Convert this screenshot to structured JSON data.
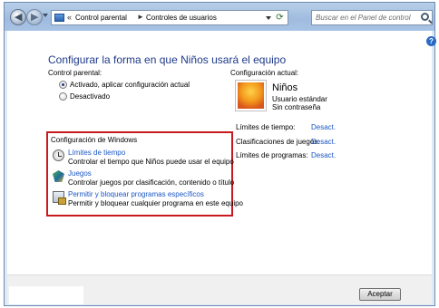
{
  "titlebar": {
    "back_icon": "back-arrow-icon",
    "forward_icon": "forward-arrow-icon",
    "address": {
      "chevron": "«",
      "segment1": "Control parental",
      "separator": "►",
      "segment2": "Controles de usuarios"
    },
    "search": {
      "placeholder": "Buscar en el Panel de control"
    }
  },
  "content": {
    "help_label": "?",
    "page_title": "Configurar la forma en que Niños usará el equipo",
    "parental_control": {
      "label": "Control parental:",
      "options": [
        {
          "label": "Activado, aplicar configuración actual",
          "checked": true
        },
        {
          "label": "Desactivado",
          "checked": false
        }
      ]
    },
    "windows_settings": {
      "label": "Configuración de Windows",
      "items": [
        {
          "icon": "clock-icon",
          "link": "Límites de tiempo",
          "desc": "Controlar el tiempo que Niños puede usar el equipo"
        },
        {
          "icon": "games-icon",
          "link": "Juegos",
          "desc": "Controlar juegos por clasificación, contenido o título"
        },
        {
          "icon": "programs-icon",
          "link": "Permitir y bloquear programas específicos",
          "desc": "Permitir y bloquear cualquier programa en este equipo"
        }
      ]
    },
    "current_config": {
      "label": "Configuración actual:",
      "user_name": "Niños",
      "account_type": "Usuario estándar",
      "password": "Sin contraseña",
      "stats": [
        {
          "label": "Límites de tiempo:",
          "value": "Desact."
        },
        {
          "label": "Clasificaciones de juegos:",
          "value": "Desact."
        },
        {
          "label": "Límites de programas:",
          "value": "Desact."
        }
      ]
    }
  },
  "footer": {
    "accept_label": "Aceptar"
  }
}
